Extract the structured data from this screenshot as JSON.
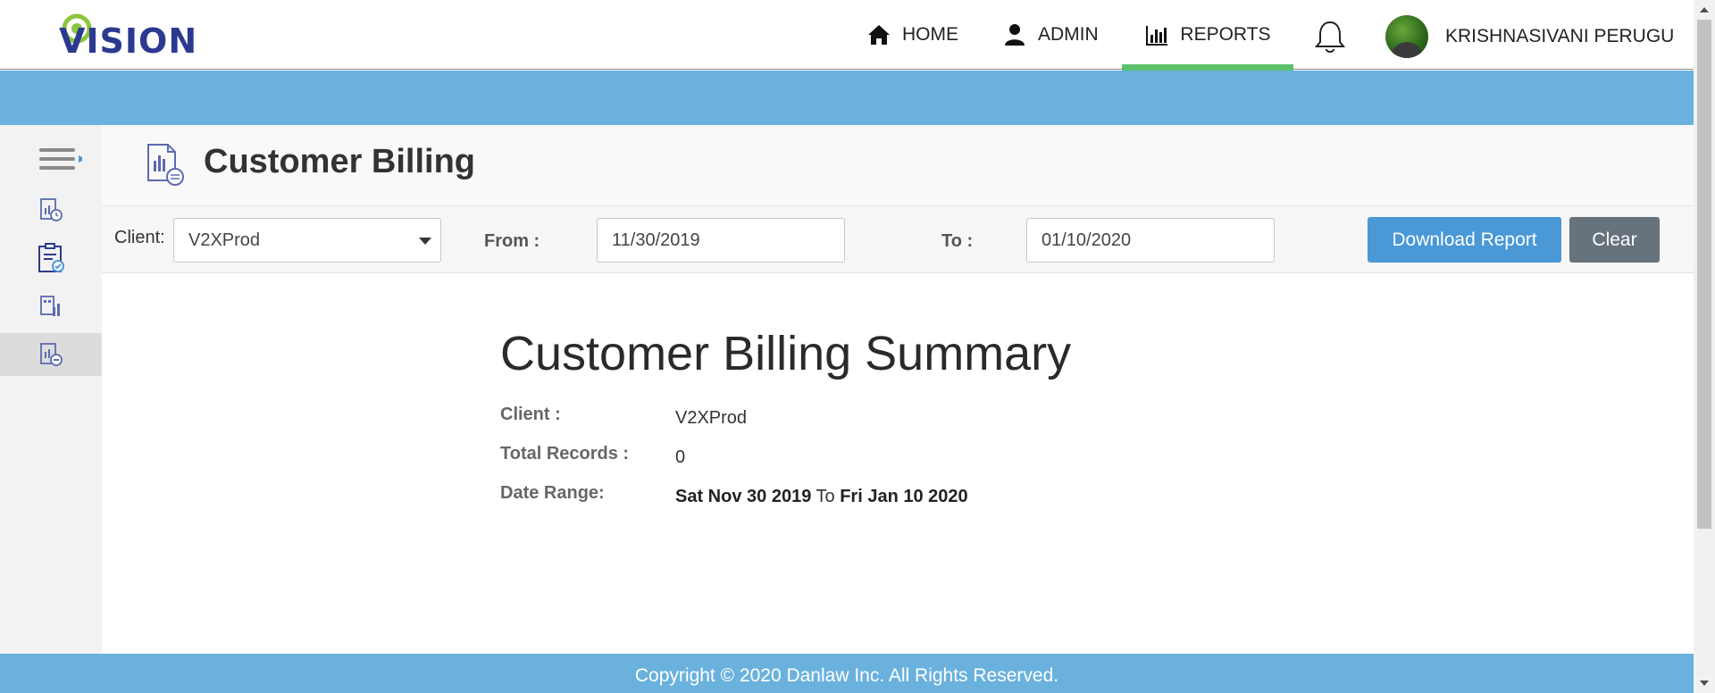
{
  "brand": {
    "logo_text": "VISION"
  },
  "nav": {
    "items": [
      {
        "label": "HOME",
        "icon": "home-icon"
      },
      {
        "label": "ADMIN",
        "icon": "user-icon"
      },
      {
        "label": "REPORTS",
        "icon": "bar-chart-icon",
        "active": true
      }
    ],
    "notifications_icon": "bell-icon",
    "username": "KRISHNASIVANI PERUGU"
  },
  "sidebar": {
    "items": [
      {
        "icon": "menu-icon"
      },
      {
        "icon": "report-clock-icon"
      },
      {
        "icon": "clipboard-check-icon"
      },
      {
        "icon": "building-chart-icon"
      },
      {
        "icon": "billing-report-icon",
        "active": true
      }
    ]
  },
  "page": {
    "title": "Customer Billing"
  },
  "filters": {
    "client_label": "Client:",
    "client_value": "V2XProd",
    "from_label": "From :",
    "from_value": "11/30/2019",
    "to_label": "To :",
    "to_value": "01/10/2020",
    "download_label": "Download Report",
    "clear_label": "Clear"
  },
  "summary": {
    "title": "Customer Billing Summary",
    "client_label": "Client :",
    "client_value": "V2XProd",
    "records_label": "Total Records :",
    "records_value": "0",
    "range_label": "Date Range:",
    "range_start": "Sat Nov 30 2019",
    "range_sep": "To",
    "range_end": "Fri Jan 10 2020"
  },
  "footer": {
    "text": "Copyright © 2020 Danlaw Inc. All Rights Reserved."
  },
  "colors": {
    "accent_blue": "#6ab1de",
    "active_nav": "#5cc16a",
    "primary_button": "#4a98d6",
    "secondary_button": "#66737d",
    "logo": "#2b3a8f"
  }
}
